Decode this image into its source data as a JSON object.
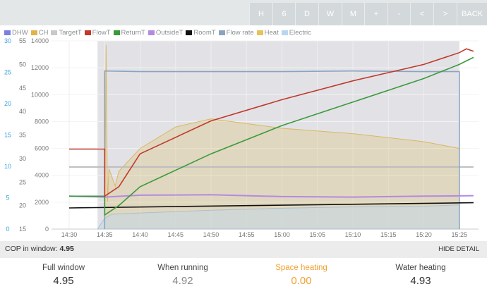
{
  "toolbar": {
    "buttons": [
      "H",
      "6",
      "D",
      "W",
      "M",
      "+",
      "-",
      "<",
      ">",
      "BACK"
    ]
  },
  "legend": [
    {
      "label": "DHW",
      "color": "#7b7fe0"
    },
    {
      "label": "CH",
      "color": "#e3b34a"
    },
    {
      "label": "TargetT",
      "color": "#c9c9c9"
    },
    {
      "label": "FlowT",
      "color": "#c0392b"
    },
    {
      "label": "ReturnT",
      "color": "#3a9a3a"
    },
    {
      "label": "OutsideT",
      "color": "#b48ae0"
    },
    {
      "label": "RoomT",
      "color": "#111111"
    },
    {
      "label": "Flow rate",
      "color": "#8aa4c0"
    },
    {
      "label": "Heat",
      "color": "#e6c35a"
    },
    {
      "label": "Electric",
      "color": "#b8d6f0"
    }
  ],
  "chart_data": {
    "type": "line",
    "x_ticks": [
      "14:30",
      "14:35",
      "14:40",
      "14:45",
      "14:50",
      "14:55",
      "15:00",
      "15:05",
      "15:10",
      "15:15",
      "15:20",
      "15:25"
    ],
    "y_axis_flowrate": [
      "0",
      "5",
      "10",
      "15",
      "20",
      "25",
      "30"
    ],
    "y_axis_temperature": [
      "15",
      "20",
      "25",
      "30",
      "35",
      "40",
      "45",
      "50",
      "55"
    ],
    "y_axis_power": [
      "0",
      "2000",
      "4000",
      "6000",
      "8000",
      "10000",
      "12000",
      "14000"
    ],
    "series": [
      {
        "name": "FlowT",
        "x": [
          0,
          5,
          5,
          7,
          10,
          20,
          30,
          40,
          50,
          55,
          56,
          57
        ],
        "y": [
          32,
          32,
          22,
          24,
          31,
          38,
          42.5,
          46.5,
          50,
          52.5,
          53.3,
          52.8
        ]
      },
      {
        "name": "ReturnT",
        "x": [
          0,
          5,
          5,
          7,
          10,
          20,
          30,
          40,
          50,
          55,
          57
        ],
        "y": [
          22,
          22,
          18,
          20,
          24,
          31,
          37,
          42,
          47,
          50,
          51.5
        ]
      },
      {
        "name": "OutsideT",
        "x": [
          0,
          5,
          10,
          20,
          30,
          40,
          50,
          57
        ],
        "y": [
          22,
          21.8,
          22.2,
          22.3,
          21.9,
          21.8,
          22.0,
          22.1
        ]
      },
      {
        "name": "RoomT",
        "x": [
          0,
          57
        ],
        "y": [
          19.5,
          20.6
        ]
      },
      {
        "name": "TargetT",
        "x": [
          0,
          57
        ],
        "y": [
          28.2,
          28.2
        ]
      },
      {
        "name": "Flow rate",
        "x": [
          5,
          5,
          10,
          20,
          30,
          40,
          50,
          55,
          55
        ],
        "y": [
          0,
          25.2,
          25.1,
          25.1,
          25.1,
          25.2,
          25.1,
          25.1,
          0
        ]
      },
      {
        "name": "Heat",
        "x": [
          5,
          5.2,
          5.4,
          5.6,
          6.5,
          7,
          10,
          15,
          20,
          30,
          40,
          50,
          55,
          55
        ],
        "y": [
          0,
          13700,
          2000,
          4500,
          3200,
          4300,
          6000,
          7600,
          8200,
          7500,
          7100,
          6500,
          6000,
          0
        ]
      },
      {
        "name": "Electric",
        "x": [
          4,
          5,
          6,
          10,
          20,
          30,
          40,
          50,
          55,
          55
        ],
        "y": [
          0,
          800,
          1100,
          1200,
          1400,
          1550,
          1650,
          1700,
          1800,
          0
        ]
      }
    ]
  },
  "stats": {
    "cop_label": "COP in window:",
    "cop_value": "4.95",
    "hide_detail": "HIDE DETAIL"
  },
  "summary": [
    {
      "label": "Full window",
      "value": "4.95",
      "color": "#333333"
    },
    {
      "label": "When running",
      "value": "4.92",
      "color": "#888888"
    },
    {
      "label": "Space heating",
      "value": "0.00",
      "color": "#f0a030"
    },
    {
      "label": "Water heating",
      "value": "4.93",
      "color": "#333333"
    }
  ]
}
